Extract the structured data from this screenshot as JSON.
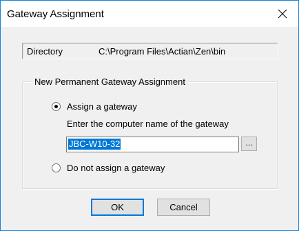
{
  "window": {
    "title": "Gateway Assignment",
    "accent_color": "#1883d7"
  },
  "directory": {
    "label": "Directory",
    "value": "C:\\Program Files\\Actian\\Zen\\bin"
  },
  "group": {
    "legend": "New Permanent Gateway Assignment",
    "assign_option": {
      "label": "Assign a gateway",
      "checked": true
    },
    "hint": "Enter the computer name of the gateway",
    "gateway_input": {
      "value": "JBC-W10-32",
      "selected": true
    },
    "browse_label": "...",
    "no_assign_option": {
      "label": "Do not assign a gateway",
      "checked": false
    }
  },
  "buttons": {
    "ok_label": "OK",
    "cancel_label": "Cancel"
  },
  "icons": {
    "close": "close-icon"
  }
}
